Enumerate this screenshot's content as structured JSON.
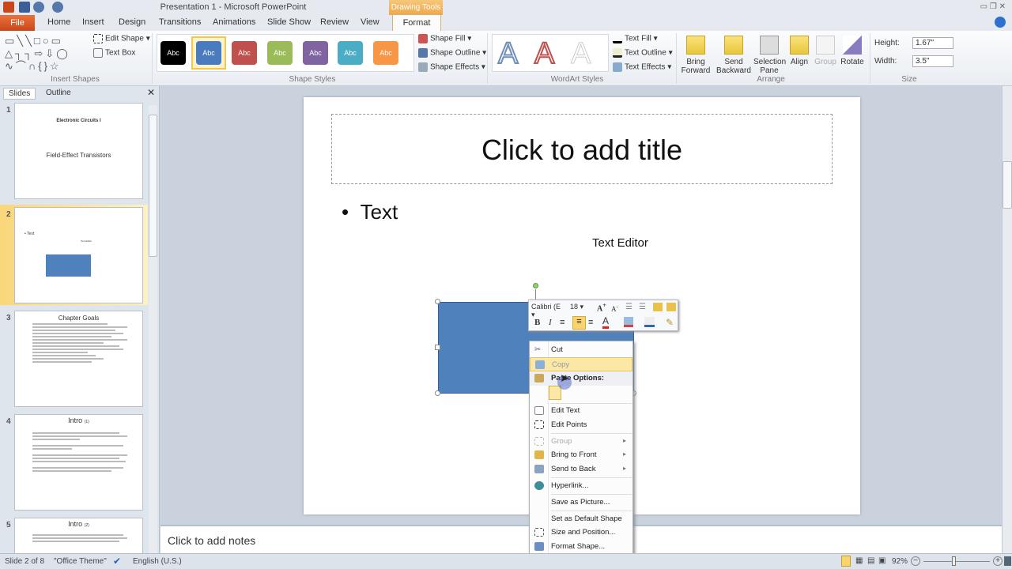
{
  "window": {
    "title": "Presentation 1  -  Microsoft PowerPoint",
    "context_tab": "Drawing Tools"
  },
  "tabs": [
    "File",
    "Home",
    "Insert",
    "Design",
    "Transitions",
    "Animations",
    "Slide Show",
    "Review",
    "View",
    "Format"
  ],
  "ribbon": {
    "insert_shapes": {
      "label": "Insert Shapes",
      "edit_shape": "Edit Shape",
      "text_box": "Text Box"
    },
    "shape_styles": {
      "label": "Shape Styles",
      "swatch_text": "Abc",
      "swatches": [
        "#000000",
        "#4a7bbf",
        "#c0504d",
        "#9bbb59",
        "#8064a2",
        "#4bacc6",
        "#f79646"
      ],
      "shape_fill": "Shape Fill",
      "shape_outline": "Shape Outline",
      "shape_effects": "Shape Effects"
    },
    "wordart": {
      "label": "WordArt Styles",
      "letter": "A",
      "text_fill": "Text Fill",
      "text_outline": "Text Outline",
      "text_effects": "Text Effects"
    },
    "arrange": {
      "label": "Arrange",
      "bring_forward": "Bring Forward",
      "send_backward": "Send Backward",
      "selection_pane": "Selection Pane",
      "align": "Align",
      "group": "Group",
      "rotate": "Rotate"
    },
    "size": {
      "label": "Size",
      "height_label": "Height:",
      "height": "1.67\"",
      "width_label": "Width:",
      "width": "3.5\""
    }
  },
  "slides_pane": {
    "tab_slides": "Slides",
    "tab_outline": "Outline",
    "thumbs": [
      {
        "num": "1",
        "title": "Electronic Circuits I",
        "subtitle": "Field-Effect Transistors"
      },
      {
        "num": "2",
        "bullet": "• Text",
        "label": "Text Editor"
      },
      {
        "num": "3",
        "title": "Chapter Goals"
      },
      {
        "num": "4",
        "title": "Intro",
        "suffix": "(1)"
      },
      {
        "num": "5",
        "title": "Intro",
        "suffix": "(2)"
      }
    ]
  },
  "slide": {
    "title_placeholder": "Click to add title",
    "bullet": "Text",
    "text_box": "Text Editor",
    "shape_color": "#4f81bd"
  },
  "notes_placeholder": "Click to add notes",
  "mini_toolbar": {
    "font": "Calibri (E",
    "size": "18"
  },
  "context_menu": {
    "items": [
      "Cut",
      "Copy",
      "Paste Options:",
      "Edit Text",
      "Edit Points",
      "Group",
      "Bring to Front",
      "Send to Back",
      "Hyperlink...",
      "Save as Picture...",
      "Set as Default Shape",
      "Size and Position...",
      "Format Shape..."
    ]
  },
  "status": {
    "slide": "Slide 2 of 8",
    "theme": "\"Office Theme\"",
    "language": "English (U.S.)",
    "zoom": "92%",
    "zoom_level": 0.46
  }
}
